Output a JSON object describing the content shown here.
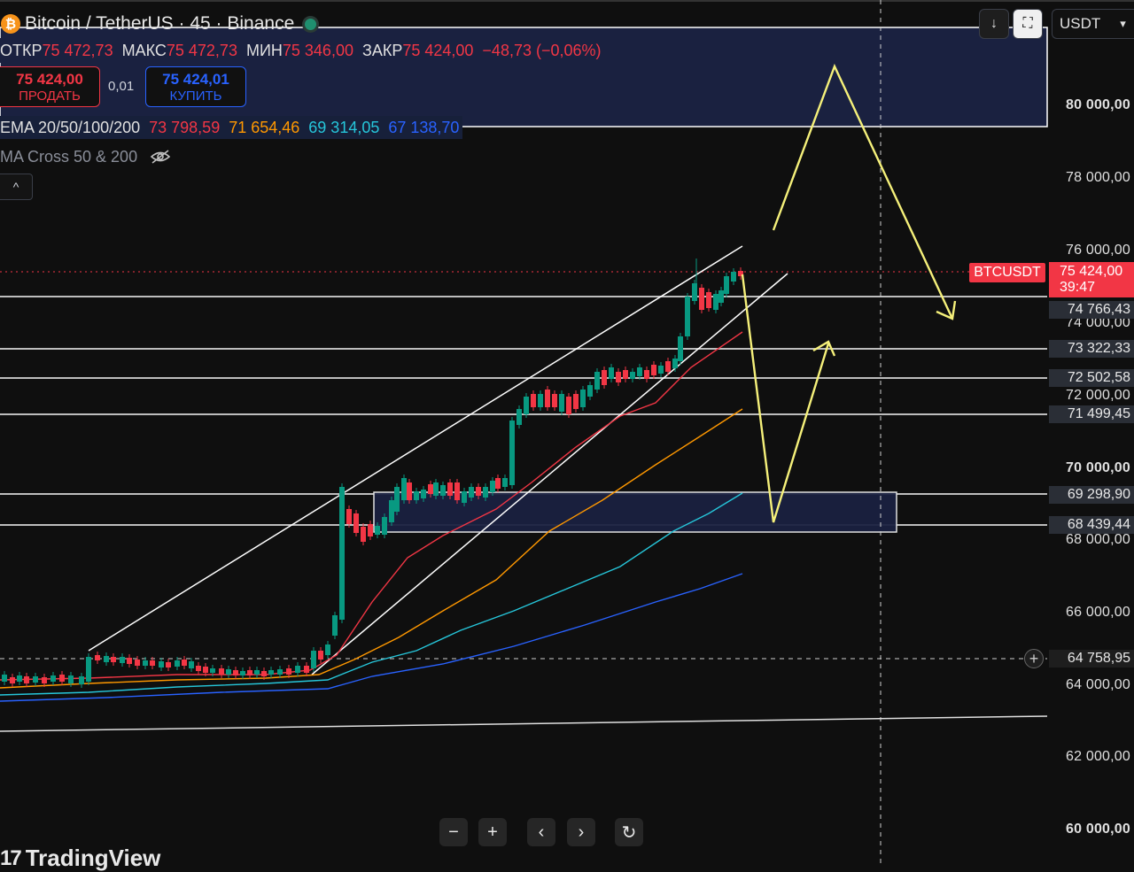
{
  "header": {
    "logo_glyph": "₿",
    "symbol": "Bitcoin / TetherUS · 45 · Binance",
    "status_color": "#1f8f6f"
  },
  "ohlc": {
    "open_label": "ОТКР",
    "open": "75 472,73",
    "high_label": "МАКС",
    "high": "75 472,73",
    "low_label": "МИН",
    "low": "75 346,00",
    "close_label": "ЗАКР",
    "close": "75 424,00",
    "change": "−48,73 (−0,06%)"
  },
  "trade": {
    "sell_price": "75 424,00",
    "sell_label": "ПРОДАТЬ",
    "spread": "0,01",
    "buy_price": "75 424,01",
    "buy_label": "КУПИТЬ"
  },
  "indicators": {
    "ema_label": "EMA 20/50/100/200",
    "ema20": "73 798,59",
    "ema50": "71 654,46",
    "ema100": "69 314,05",
    "ema200": "67 138,70",
    "ema_colors": [
      "#f23645",
      "#ff9800",
      "#26c6da",
      "#2962ff"
    ],
    "ma_cross_label": "MA Cross 50 & 200",
    "collapse_glyph": "^"
  },
  "toolbar": {
    "currency": "USDT",
    "down_glyph": "↓",
    "fullscreen_glyph": "⛶"
  },
  "price_scale": {
    "labels": [
      "80 000,00",
      "78 000,00",
      "76 000,00",
      "74 000,00",
      "72 000,00",
      "70 000,00",
      "68 000,00",
      "66 000,00",
      "64 000,00",
      "62 000,00",
      "60 000,00"
    ],
    "level_tags": [
      "74 766,43",
      "73 322,33",
      "72 502,58",
      "71 499,45",
      "69 298,90",
      "68 439,44"
    ],
    "crosshair_price": "64 758,95",
    "current_price": "75 424,00",
    "countdown": "39:47",
    "symbol_tag": "BTCUSDT"
  },
  "bottom_nav": {
    "zoom_out": "−",
    "zoom_in": "+",
    "scroll_left": "‹",
    "scroll_right": "›",
    "reset": "↻"
  },
  "brand": {
    "name": "TradingView",
    "mark": "17"
  }
}
